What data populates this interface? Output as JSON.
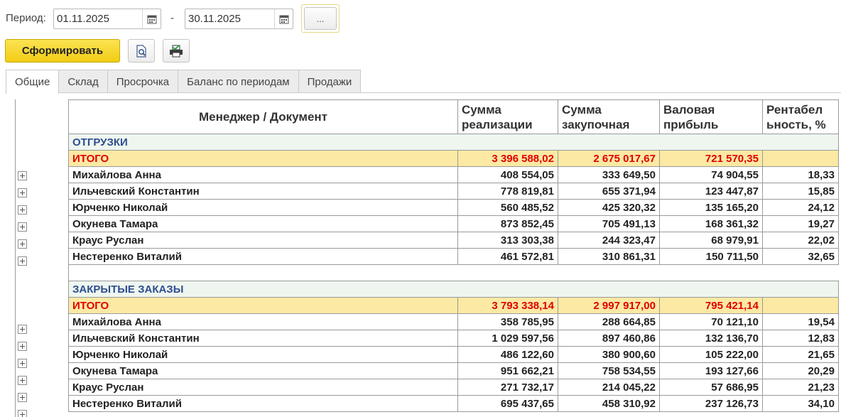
{
  "period": {
    "label": "Период:",
    "from": "01.11.2025",
    "separator": "-",
    "to": "30.11.2025",
    "more_label": "..."
  },
  "toolbar": {
    "generate_label": "Сформировать",
    "preview_icon": "print-preview-icon",
    "print_icon": "printer-icon"
  },
  "tabs": [
    {
      "label": "Общие",
      "active": true
    },
    {
      "label": "Склад",
      "active": false
    },
    {
      "label": "Просрочка",
      "active": false
    },
    {
      "label": "Баланс по периодам",
      "active": false
    },
    {
      "label": "Продажи",
      "active": false
    }
  ],
  "report": {
    "headers": {
      "manager": "Менеджер / Документ",
      "sales_1": "Сумма",
      "sales_2": "реализации",
      "purchase_1": "Сумма",
      "purchase_2": "закупочная",
      "gross_1": "Валовая",
      "gross_2": "прибыль",
      "profit_1": "Рентабел",
      "profit_2": "ьность, %"
    },
    "sections": [
      {
        "title": "ОТГРУЗКИ",
        "total": {
          "label": "ИТОГО",
          "sales": "3 396 588,02",
          "purchase": "2 675 017,67",
          "gross": "721 570,35",
          "profit": ""
        },
        "rows": [
          {
            "name": "Михайлова Анна",
            "sales": "408 554,05",
            "purchase": "333 649,50",
            "gross": "74 904,55",
            "profit": "18,33"
          },
          {
            "name": "Ильчевский Константин",
            "sales": "778 819,81",
            "purchase": "655 371,94",
            "gross": "123 447,87",
            "profit": "15,85"
          },
          {
            "name": "Юрченко Николай",
            "sales": "560 485,52",
            "purchase": "425 320,32",
            "gross": "135 165,20",
            "profit": "24,12"
          },
          {
            "name": "Окунева Тамара",
            "sales": "873 852,45",
            "purchase": "705 491,13",
            "gross": "168 361,32",
            "profit": "19,27"
          },
          {
            "name": "Краус Руслан",
            "sales": "313 303,38",
            "purchase": "244 323,47",
            "gross": "68 979,91",
            "profit": "22,02"
          },
          {
            "name": "Нестеренко Виталий",
            "sales": "461 572,81",
            "purchase": "310 861,31",
            "gross": "150 711,50",
            "profit": "32,65"
          }
        ]
      },
      {
        "title": "ЗАКРЫТЫЕ ЗАКАЗЫ",
        "total": {
          "label": "ИТОГО",
          "sales": "3 793 338,14",
          "purchase": "2 997 917,00",
          "gross": "795 421,14",
          "profit": ""
        },
        "rows": [
          {
            "name": "Михайлова Анна",
            "sales": "358 785,95",
            "purchase": "288 664,85",
            "gross": "70 121,10",
            "profit": "19,54"
          },
          {
            "name": "Ильчевский Константин",
            "sales": "1 029 597,56",
            "purchase": "897 460,86",
            "gross": "132 136,70",
            "profit": "12,83"
          },
          {
            "name": "Юрченко Николай",
            "sales": "486 122,60",
            "purchase": "380 900,60",
            "gross": "105 222,00",
            "profit": "21,65"
          },
          {
            "name": "Окунева Тамара",
            "sales": "951 662,21",
            "purchase": "758 534,55",
            "gross": "193 127,66",
            "profit": "20,29"
          },
          {
            "name": "Краус Руслан",
            "sales": "271 732,17",
            "purchase": "214 045,22",
            "gross": "57 686,95",
            "profit": "21,23"
          },
          {
            "name": "Нестеренко Виталий",
            "sales": "695 437,65",
            "purchase": "458 310,92",
            "gross": "237 126,73",
            "profit": "34,10"
          }
        ]
      }
    ]
  },
  "colors": {
    "accent_button": "#f2cc15",
    "total_background": "#fbe9a4",
    "total_text": "#e00000",
    "section_background": "#eef6ef",
    "section_text": "#2e4e8f"
  }
}
